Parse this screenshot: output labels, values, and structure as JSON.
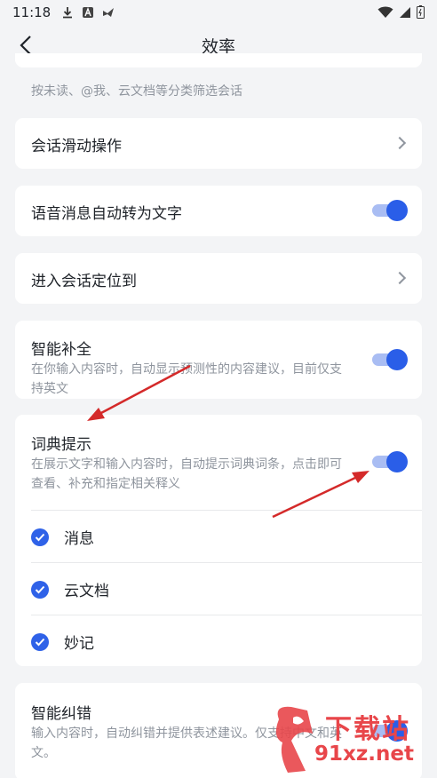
{
  "status_bar": {
    "time": "11:18"
  },
  "nav": {
    "title": "效率",
    "back_icon": "chevron-left-icon"
  },
  "filter_card": {
    "description": "按未读、@我、云文档等分类筛选会话"
  },
  "settings": [
    {
      "id": "swipe",
      "title": "会话滑动操作",
      "control": "chevron"
    },
    {
      "id": "voice",
      "title": "语音消息自动转为文字",
      "control": "toggle",
      "on": true
    },
    {
      "id": "locate",
      "title": "进入会话定位到",
      "control": "chevron"
    },
    {
      "id": "autocomplete",
      "title": "智能补全",
      "description": "在你输入内容时，自动显示预测性的内容建议，目前仅支持英文",
      "control": "toggle",
      "on": true
    },
    {
      "id": "dictionary",
      "title": "词典提示",
      "description": "在展示文字和输入内容时，自动提示词典词条，点击即可查看、补充和指定相关释义",
      "control": "toggle",
      "on": true
    },
    {
      "id": "spellcheck",
      "title": "智能纠错",
      "description": "输入内容时，自动纠错并提供表述建议。仅支持中文和英文。",
      "control": "toggle",
      "on": true
    }
  ],
  "dictionary_options": [
    {
      "label": "消息",
      "checked": true
    },
    {
      "label": "云文档",
      "checked": true
    },
    {
      "label": "妙记",
      "checked": true
    }
  ],
  "watermark": {
    "text_top": "下载站",
    "text_bottom": "91xz.net"
  },
  "colors": {
    "accent": "#2a5ee8",
    "toggle_track": "#a9bdf3",
    "background": "#f3f4f6",
    "annotation_arrow": "#d42a2a"
  }
}
